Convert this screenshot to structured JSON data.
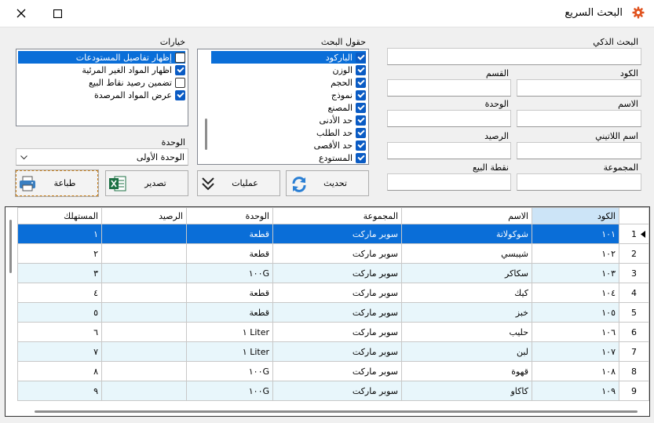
{
  "window": {
    "title": "البحث السريع"
  },
  "labels": {
    "smart_search": "البحث الذكي",
    "code": "الكود",
    "section": "القسم",
    "name": "الاسم",
    "unit": "الوحدة",
    "latin_name": "اسم اللاتيني",
    "balance": "الرصيد",
    "group": "المجموعة",
    "sale_point": "نقطة البيع",
    "search_fields": "حقول البحث",
    "options": "خيارات",
    "unit_select": "الوحدة"
  },
  "search_fields": [
    {
      "label": "الباركود",
      "checked": true,
      "selected": true
    },
    {
      "label": "الوزن",
      "checked": true
    },
    {
      "label": "الحجم",
      "checked": true
    },
    {
      "label": "نموذج",
      "checked": true
    },
    {
      "label": "المصنع",
      "checked": true
    },
    {
      "label": "حد الأدنى",
      "checked": true
    },
    {
      "label": "حد الطلب",
      "checked": true
    },
    {
      "label": "حد الأقصى",
      "checked": true
    },
    {
      "label": "المستودع",
      "checked": true
    }
  ],
  "options": [
    {
      "label": "إظهار تفاصيل المستودعات",
      "checked": false,
      "selected": true
    },
    {
      "label": "اظهار المواد الغير المرئية",
      "checked": true
    },
    {
      "label": "تضمين رصيد نقاط البيع",
      "checked": false
    },
    {
      "label": "عرض المواد المرصدة",
      "checked": true
    }
  ],
  "unit_dropdown": {
    "value": "الوحدة الأولى"
  },
  "buttons": {
    "print": "طباعة",
    "export": "تصدير",
    "operations": "عمليات",
    "refresh": "تحديث"
  },
  "grid": {
    "columns": [
      "الكود",
      "الاسم",
      "المجموعة",
      "الوحدة",
      "الرصيد",
      "المستهلك"
    ],
    "rows": [
      {
        "num": "1",
        "code": "١٠١",
        "name": "شوكولاتة",
        "group": "سوبر ماركت",
        "unit": "قطعة",
        "balance": "",
        "consumer": "١"
      },
      {
        "num": "2",
        "code": "١٠٢",
        "name": "شيبسي",
        "group": "سوبر ماركت",
        "unit": "قطعة",
        "balance": "",
        "consumer": "٢"
      },
      {
        "num": "3",
        "code": "١٠٣",
        "name": "سكاكر",
        "group": "سوبر ماركت",
        "unit": "١٠٠G",
        "balance": "",
        "consumer": "٣"
      },
      {
        "num": "4",
        "code": "١٠٤",
        "name": "كيك",
        "group": "سوبر ماركت",
        "unit": "قطعة",
        "balance": "",
        "consumer": "٤"
      },
      {
        "num": "5",
        "code": "١٠٥",
        "name": "خبز",
        "group": "سوبر ماركت",
        "unit": "قطعة",
        "balance": "",
        "consumer": "٥"
      },
      {
        "num": "6",
        "code": "١٠٦",
        "name": "حليب",
        "group": "سوبر ماركت",
        "unit": "Liter ١",
        "balance": "",
        "consumer": "٦"
      },
      {
        "num": "7",
        "code": "١٠٧",
        "name": "لبن",
        "group": "سوبر ماركت",
        "unit": "Liter ١",
        "balance": "",
        "consumer": "٧"
      },
      {
        "num": "8",
        "code": "١٠٨",
        "name": "قهوة",
        "group": "سوبر ماركت",
        "unit": "١٠٠G",
        "balance": "",
        "consumer": "٨"
      },
      {
        "num": "9",
        "code": "١٠٩",
        "name": "كاكاو",
        "group": "سوبر ماركت",
        "unit": "١٠٠G",
        "balance": "",
        "consumer": "٩"
      }
    ]
  },
  "colors": {
    "accent": "#0a6ed8",
    "alt_row": "#e8f6fb",
    "gear": "#e0531f"
  }
}
